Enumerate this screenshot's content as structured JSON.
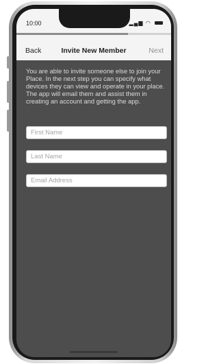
{
  "status_bar": {
    "time": "10:00",
    "icons": "…ıl ◉"
  },
  "loading_progress": 0.72,
  "nav": {
    "back_label": "Back",
    "title": "Invite New Member",
    "next_label": "Next"
  },
  "intro_text": "You are able to invite someone else to join your Place. In the next step you can specify what devices they can view and operate in your place.  The app will email them and assist them in creating an account and getting the app.",
  "form": {
    "first_name": {
      "placeholder": "First Name",
      "value": ""
    },
    "last_name": {
      "placeholder": "Last Name",
      "value": ""
    },
    "email": {
      "placeholder": "Email Address",
      "value": ""
    }
  }
}
